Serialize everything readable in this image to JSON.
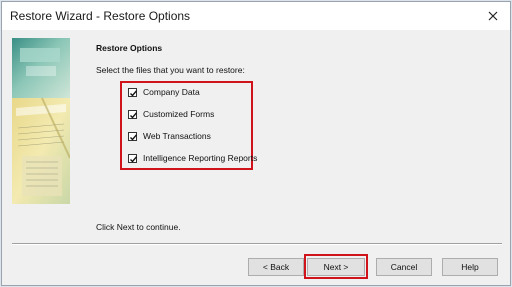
{
  "window": {
    "title": "Restore Wizard - Restore Options",
    "close_icon": "close-icon"
  },
  "main": {
    "heading": "Restore Options",
    "prompt": "Select the files that you want to restore:",
    "options": [
      {
        "label": "Company Data",
        "checked": true
      },
      {
        "label": "Customized Forms",
        "checked": true
      },
      {
        "label": "Web Transactions",
        "checked": true
      },
      {
        "label": "Intelligence Reporting Reports",
        "checked": true
      }
    ],
    "footer_text": "Click Next to continue."
  },
  "buttons": {
    "back": "< Back",
    "next": "Next >",
    "cancel": "Cancel",
    "help": "Help"
  },
  "colors": {
    "highlight": "#d0121b",
    "dialog_bg": "#f0f0f0"
  }
}
